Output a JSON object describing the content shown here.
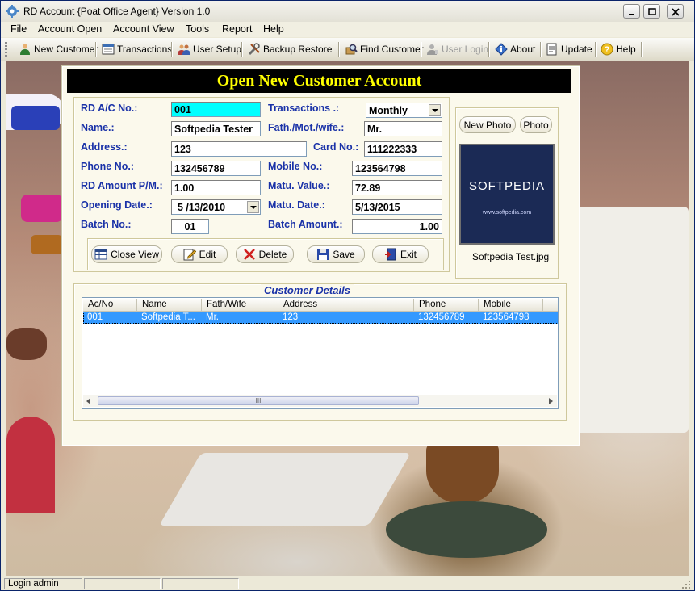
{
  "window": {
    "title": "RD Account {Poat Office Agent} Version 1.0"
  },
  "menu": [
    "File",
    "Account Open",
    "Account View",
    "Tools",
    "Report",
    "Help"
  ],
  "toolbar": [
    {
      "label": "New Customer",
      "icon": "person-icon"
    },
    {
      "label": "Transactions",
      "icon": "ledger-icon"
    },
    {
      "label": "User Setup",
      "icon": "users-icon"
    },
    {
      "label": "Backup  Restore",
      "icon": "tools-icon"
    },
    {
      "label": "Find Customer",
      "icon": "find-icon"
    },
    {
      "label": "User Login",
      "icon": "user-login-icon",
      "disabled": true
    },
    {
      "label": "About",
      "icon": "about-icon"
    },
    {
      "label": "Update",
      "icon": "update-icon"
    },
    {
      "label": "Help",
      "icon": "help-icon"
    }
  ],
  "dialog": {
    "title": "Open New Customer Account",
    "fields": {
      "rd_ac_no": {
        "label": "RD A/C  No.:",
        "value": "001"
      },
      "transactions": {
        "label": "Transactions .:",
        "value": "Monthly"
      },
      "name": {
        "label": "Name.:",
        "value": "Softpedia Tester"
      },
      "fath_mot_wife": {
        "label": "Fath./Mot./wife.:",
        "value": "Mr."
      },
      "address": {
        "label": "Address.:",
        "value": "123"
      },
      "card_no": {
        "label": "Card No.:",
        "value": "111222333"
      },
      "phone_no": {
        "label": "Phone No.:",
        "value": "132456789"
      },
      "mobile_no": {
        "label": "Mobile No.:",
        "value": "123564798"
      },
      "rd_amount": {
        "label": "RD Amount P/M.:",
        "value": "1.00"
      },
      "matu_value": {
        "label": "Matu. Value.:",
        "value": "72.89"
      },
      "opening_date": {
        "label": "Opening Date.:",
        "value": "5 /13/2010"
      },
      "matu_date": {
        "label": "Matu. Date.:",
        "value": "5/13/2015"
      },
      "batch_no": {
        "label": "Batch No.:",
        "value": "01"
      },
      "batch_amount": {
        "label": "Batch Amount.:",
        "value": "1.00"
      }
    },
    "actions": [
      "Close View",
      "Edit",
      "Delete",
      "Save",
      "Exit"
    ],
    "photo": {
      "new_photo_label": "New Photo",
      "photo_label": "Photo",
      "image_text": "SOFTPEDIA",
      "image_url_text": "www.softpedia.com",
      "caption": "Softpedia Test.jpg"
    },
    "customer_details": {
      "legend": "Customer Details",
      "columns": [
        "Ac/No",
        "Name",
        "Fath/Wife",
        "Address",
        "Phone",
        "Mobile"
      ],
      "rows": [
        [
          "001",
          "Softpedia T...",
          "Mr.",
          "123",
          "132456789",
          "123564798"
        ]
      ],
      "scroll_grip": "III"
    }
  },
  "status": {
    "login": "Login admin"
  },
  "colors": {
    "accent_field": "#00ffff",
    "label_blue": "#1a32a8",
    "title_yellow": "#ffff00",
    "selection": "#3399ff"
  }
}
